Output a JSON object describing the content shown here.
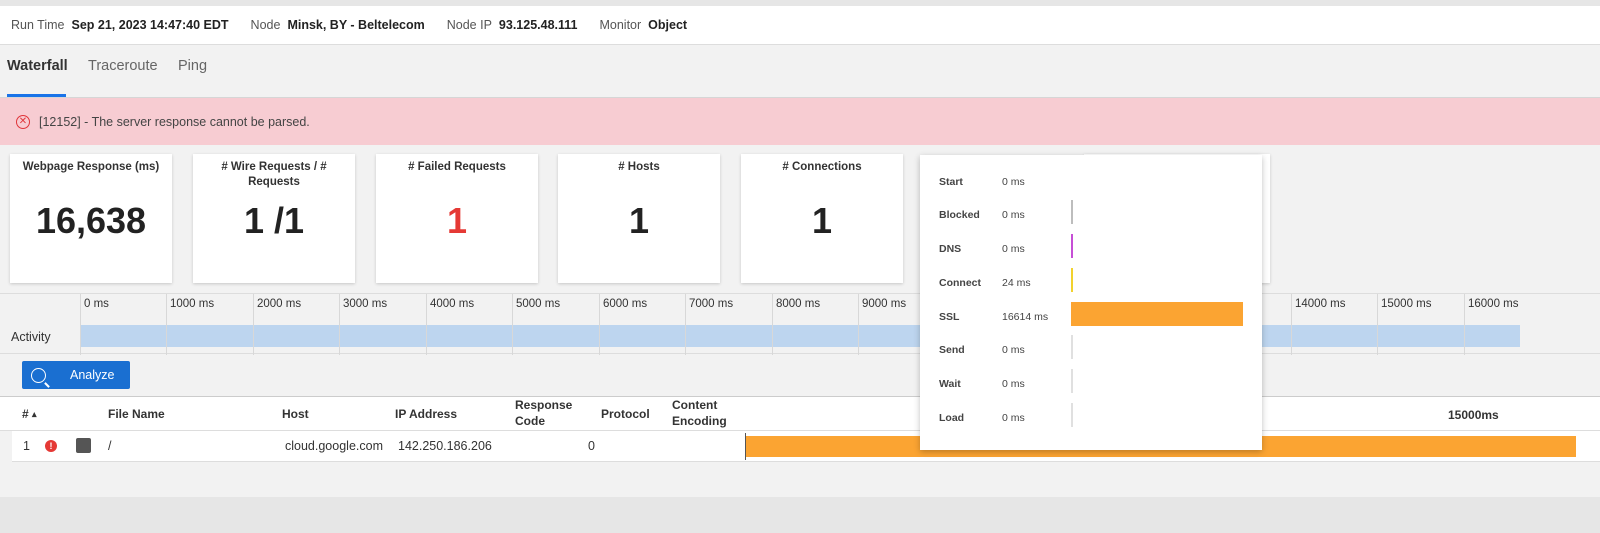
{
  "run_info": {
    "run_time_label": "Run Time",
    "run_time_value": "Sep 21, 2023 14:47:40 EDT",
    "node_label": "Node",
    "node_value": "Minsk, BY - Beltelecom",
    "node_ip_label": "Node IP",
    "node_ip_value": "93.125.48.111",
    "monitor_label": "Monitor",
    "monitor_value": "Object"
  },
  "tabs": [
    {
      "label": "Waterfall",
      "active": true
    },
    {
      "label": "Traceroute",
      "active": false
    },
    {
      "label": "Ping",
      "active": false
    }
  ],
  "error": {
    "icon": "error-circle-x-icon",
    "message": "[12152] - The server response cannot be parsed."
  },
  "cards": [
    {
      "title": "Webpage Response (ms)",
      "value": "16,638"
    },
    {
      "title": "# Wire Requests / # Requests",
      "value": "1 /1"
    },
    {
      "title": "# Failed Requests",
      "value": "1"
    },
    {
      "title": "# Hosts",
      "value": "1"
    },
    {
      "title": "# Connections",
      "value": "1"
    }
  ],
  "timeline": {
    "ticks": [
      "0 ms",
      "1000 ms",
      "2000 ms",
      "3000 ms",
      "4000 ms",
      "5000 ms",
      "6000 ms",
      "7000 ms",
      "8000 ms",
      "9000 ms",
      "14000 ms",
      "15000 ms",
      "16000 ms"
    ],
    "activity_label": "Activity"
  },
  "analyze_label": "Analyze",
  "table": {
    "headers": {
      "num": "#",
      "sort_glyph": "▴",
      "file_name": "File Name",
      "host": "Host",
      "ip": "IP Address",
      "resp_1": "Response",
      "resp_2": "Code",
      "protocol": "Protocol",
      "enc_1": "Content",
      "enc_2": "Encoding",
      "scale_label": "15000ms"
    },
    "rows": [
      {
        "num": "1",
        "status_icon": "error-icon",
        "secure_icon": "lock-icon",
        "file_name": "/",
        "host": "cloud.google.com",
        "ip": "142.250.186.206",
        "response_code": "0",
        "protocol": "",
        "encoding": ""
      }
    ]
  },
  "timing_popover": {
    "rows": [
      {
        "name": "Start",
        "value": "0 ms",
        "ms": 0,
        "color": "#bdbdbd"
      },
      {
        "name": "Blocked",
        "value": "0 ms",
        "ms": 0,
        "color": "#bdbdbd"
      },
      {
        "name": "DNS",
        "value": "0 ms",
        "ms": 0,
        "color": "#c64fd6"
      },
      {
        "name": "Connect",
        "value": "24 ms",
        "ms": 24,
        "color": "#f2d22e"
      },
      {
        "name": "SSL",
        "value": "16614 ms",
        "ms": 16614,
        "color": "#fba432"
      },
      {
        "name": "Send",
        "value": "0 ms",
        "ms": 0,
        "color": "#e0e0e0"
      },
      {
        "name": "Wait",
        "value": "0 ms",
        "ms": 0,
        "color": "#e0e0e0"
      },
      {
        "name": "Load",
        "value": "0 ms",
        "ms": 0,
        "color": "#e0e0e0"
      }
    ]
  },
  "colors": {
    "accent": "#1a6fd1",
    "error_bg": "#f7ccd2",
    "error_red": "#e53935",
    "activity_bar": "#bdd5ef",
    "waterfall_bar": "#fba432"
  }
}
